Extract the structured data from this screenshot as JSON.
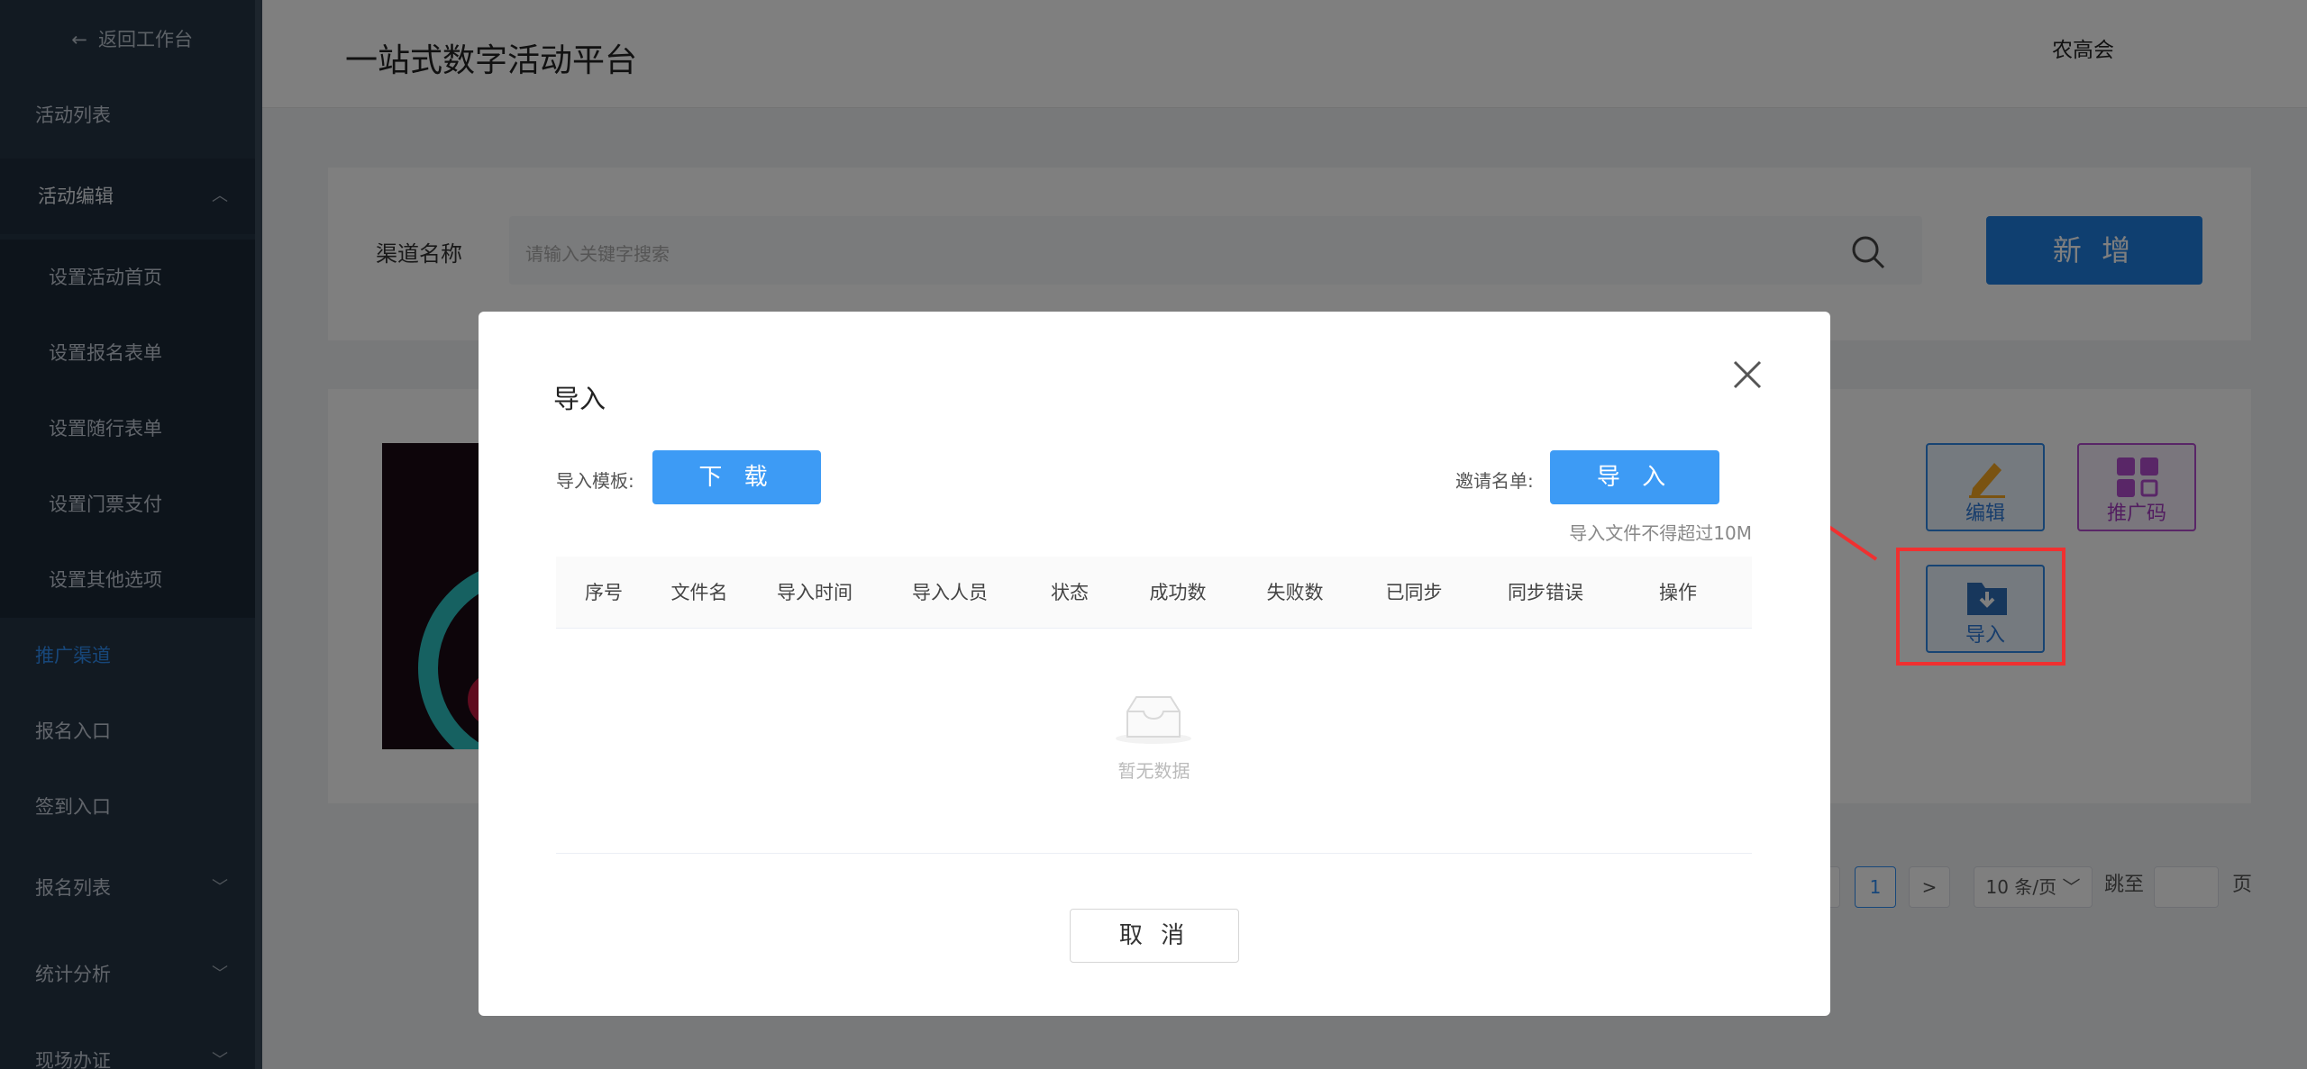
{
  "sidebar": {
    "back": "返回工作台",
    "items": [
      {
        "label": "活动列表"
      },
      {
        "label": "活动编辑"
      },
      {
        "label": "设置活动首页"
      },
      {
        "label": "设置报名表单"
      },
      {
        "label": "设置随行表单"
      },
      {
        "label": "设置门票支付"
      },
      {
        "label": "设置其他选项"
      },
      {
        "label": "推广渠道"
      },
      {
        "label": "报名入口"
      },
      {
        "label": "签到入口"
      },
      {
        "label": "报名列表"
      },
      {
        "label": "统计分析"
      },
      {
        "label": "现场办证"
      }
    ]
  },
  "header": {
    "title": "一站式数字活动平台",
    "user": "农高会"
  },
  "search": {
    "label": "渠道名称",
    "placeholder": "请输入关键字搜索",
    "new_button": "新 增"
  },
  "channel_actions": {
    "edit": "编辑",
    "promo_code": "推广码",
    "import": "导入"
  },
  "pagination": {
    "current_page": "1",
    "page_size": "10 条/页",
    "jump_label": "跳至",
    "page_suffix": "页"
  },
  "modal": {
    "title": "导入",
    "template_label": "导入模板:",
    "download_button": "下 载",
    "invite_label": "邀请名单:",
    "import_button": "导 入",
    "size_limit": "导入文件不得超过10M",
    "columns": [
      "序号",
      "文件名",
      "导入时间",
      "导入人员",
      "状态",
      "成功数",
      "失败数",
      "已同步",
      "同步错误",
      "操作"
    ],
    "empty_text": "暂无数据",
    "cancel_button": "取 消"
  },
  "colors": {
    "primary": "#3d9bf5",
    "sidebar_bg": "#243444",
    "annotation_red": "#f03030"
  }
}
